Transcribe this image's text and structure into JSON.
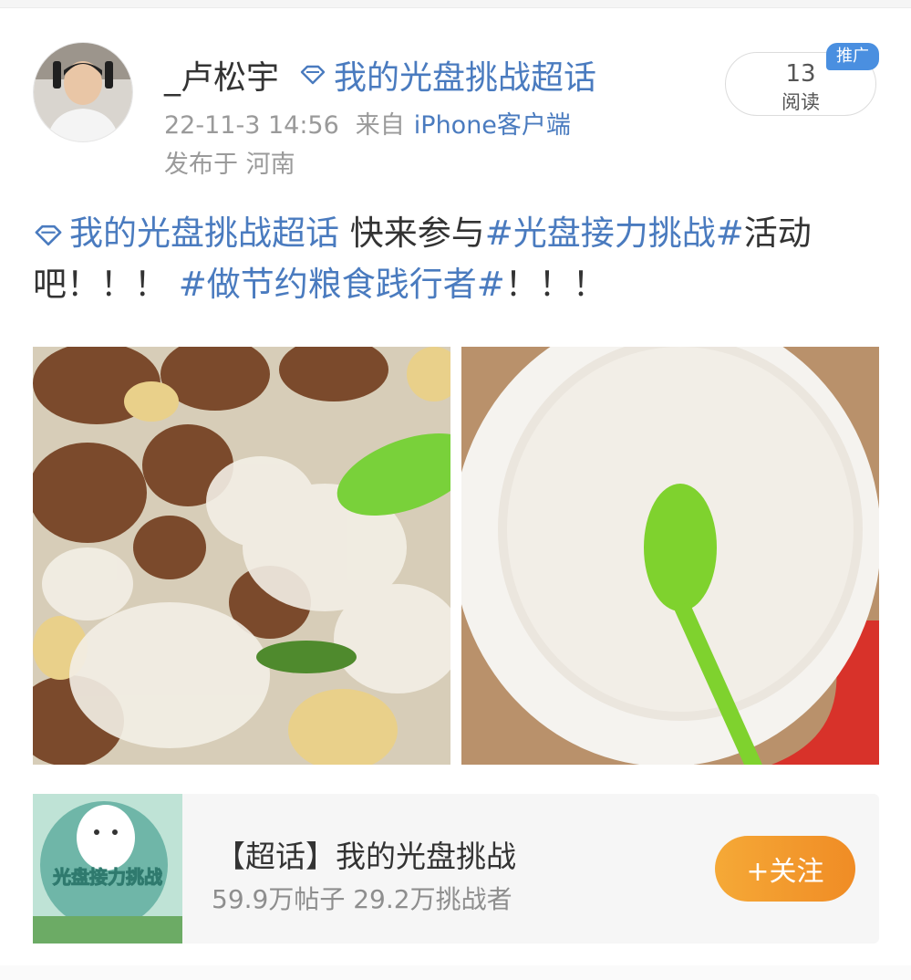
{
  "post": {
    "username": "_卢松宇",
    "topic_link": "我的光盘挑战超话",
    "time": "22-11-3 14:56",
    "from_label": "来自",
    "source": "iPhone客户端",
    "location": "发布于 河南",
    "read_count": "13",
    "read_label": "阅读",
    "promo_badge": "推广",
    "body": {
      "topic_link": "我的光盘挑战超话",
      "text1": " 快来参与",
      "hashtag1": "#光盘接力挑战#",
      "text2": "活动吧！！！ ",
      "hashtag2": "#做节约粮食践行者#",
      "text3": "！！！"
    }
  },
  "topic_card": {
    "title": "【超话】我的光盘挑战",
    "stats": "59.9万帖子 29.2万挑战者",
    "follow_label": "+关注",
    "thumb_text": "光盘接力挑战"
  },
  "colors": {
    "link": "#4a7bbf",
    "follow_button": "#f29a2d",
    "promo_badge": "#4a8fe0"
  },
  "icons": {
    "topic": "diamond-icon"
  }
}
